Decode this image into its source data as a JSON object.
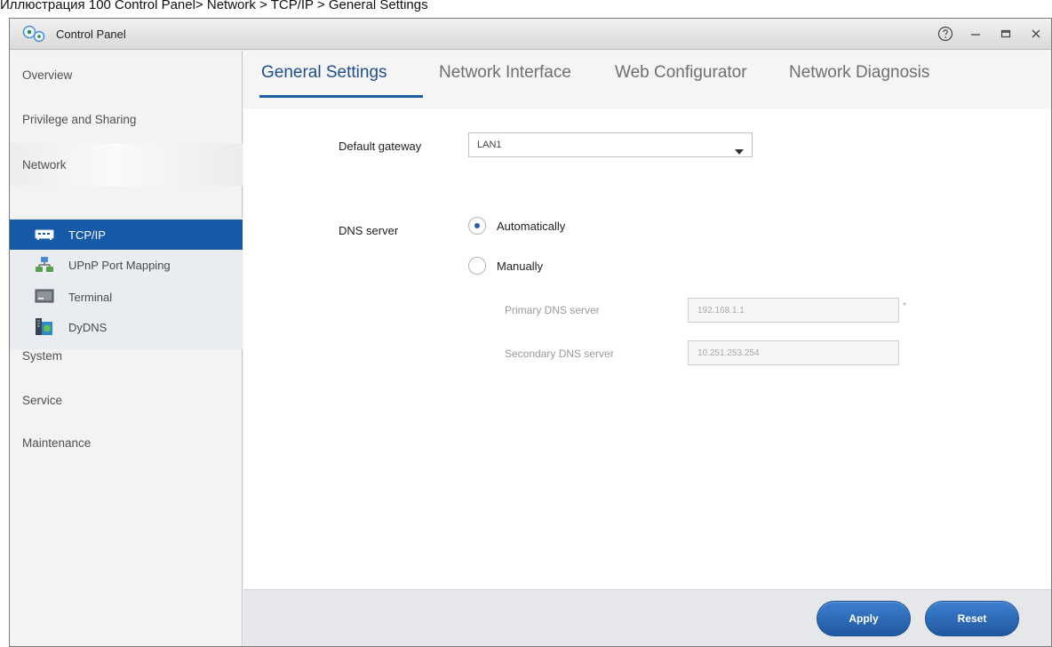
{
  "caption": "Иллюстрация 100 Control Panel> Network > TCP/IP > General Settings",
  "window": {
    "title": "Control Panel",
    "controls": [
      "help-icon",
      "minimize-icon",
      "maximize-icon",
      "close-icon"
    ]
  },
  "sidebar": {
    "items": [
      {
        "label": "Overview"
      },
      {
        "label": "Privilege and Sharing"
      },
      {
        "label": "Network",
        "expanded": true
      },
      {
        "label": "System"
      },
      {
        "label": "Service"
      },
      {
        "label": "Maintenance"
      }
    ],
    "network_children": [
      {
        "label": "TCP/IP",
        "icon": "tcpip-icon",
        "active": true
      },
      {
        "label": "UPnP Port Mapping",
        "icon": "upnp-icon"
      },
      {
        "label": "Terminal",
        "icon": "terminal-icon"
      },
      {
        "label": "DyDNS",
        "icon": "dydns-icon"
      }
    ]
  },
  "tabs": [
    {
      "label": "General Settings",
      "active": true
    },
    {
      "label": "Network Interface"
    },
    {
      "label": "Web Configurator"
    },
    {
      "label": "Network Diagnosis"
    }
  ],
  "form": {
    "default_gateway": {
      "label": "Default gateway",
      "value": "LAN1"
    },
    "dns": {
      "label": "DNS server",
      "options": [
        {
          "label": "Automatically",
          "checked": true
        },
        {
          "label": "Manually",
          "checked": false
        }
      ],
      "primary": {
        "label": "Primary DNS server",
        "value": "192.168.1.1"
      },
      "secondary": {
        "label": "Secondary DNS server",
        "value": "10.251.253.254"
      },
      "required_mark": "*"
    }
  },
  "footer": {
    "apply_label": "Apply",
    "reset_label": "Reset"
  },
  "colors": {
    "accent": "#175ba8",
    "tab_active": "#1f4f8a",
    "button": "#2b67b3",
    "sidebar_bg": "#f3f3f3",
    "subnav_bg": "#e9ecf1"
  }
}
